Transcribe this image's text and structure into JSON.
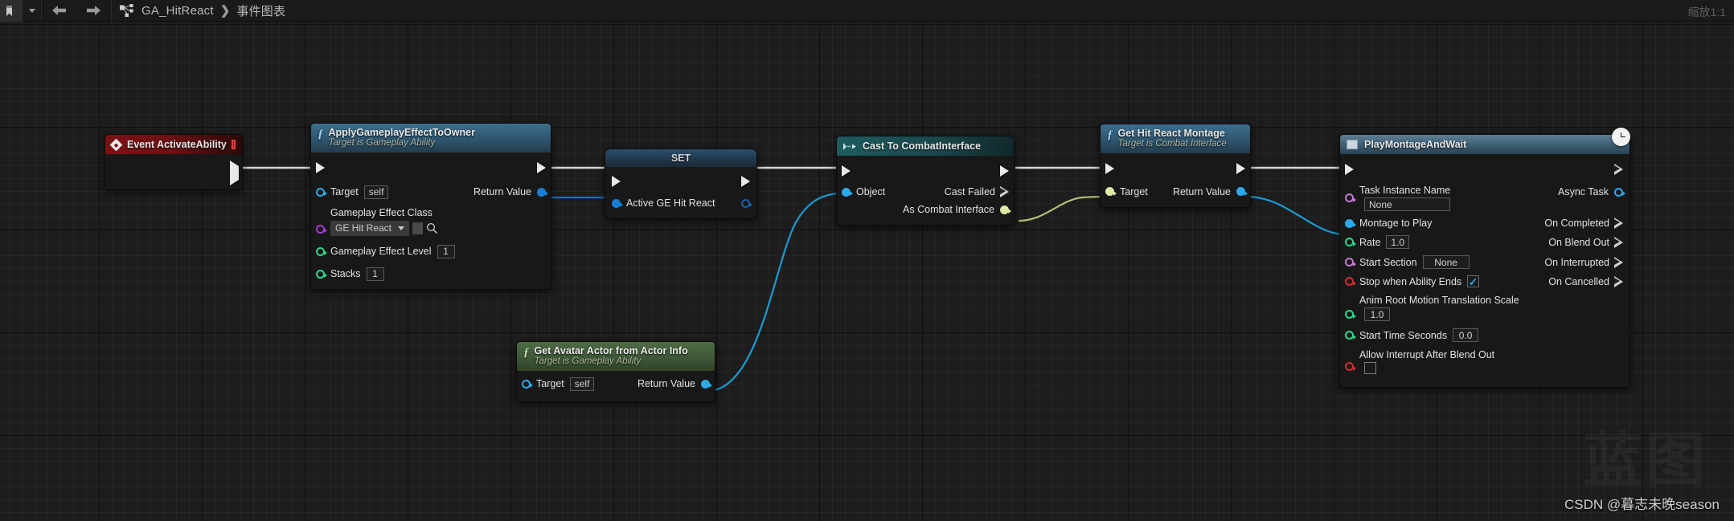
{
  "window": {
    "zoom_label": "缩放1:1"
  },
  "toolbar": {
    "bookmark_icon": "bookmark-icon",
    "bookmark_caret_icon": "chevron-down-icon",
    "back_icon": "arrow-left-icon",
    "forward_icon": "arrow-right-icon",
    "graph_icon": "blueprint-graph-icon",
    "breadcrumb": {
      "blueprint": "GA_HitReact",
      "separator": "❯",
      "graph": "事件图表"
    }
  },
  "watermark": {
    "big": "蓝图",
    "credit": "CSDN @暮志未晚season"
  },
  "nodes": {
    "event_activate_ability": {
      "title": "Event ActivateAbility",
      "icon": "event-diamond-icon",
      "stop_icon": "stop-square-icon",
      "exec_out": "exec-out-pin"
    },
    "apply_gameplay_effect": {
      "title": "ApplyGameplayEffectToOwner",
      "subtitle": "Target is Gameplay Ability",
      "icon": "function-f-icon",
      "inputs": [
        {
          "label": "Target",
          "value": "self",
          "pin_color": "#2da8e8",
          "pin_style": "hollow"
        },
        {
          "label": "Gameplay Effect Class",
          "value": "GE Hit React",
          "pin_color": "#a33bd6",
          "pin_style": "hollow",
          "kind": "class-combo"
        },
        {
          "label": "Gameplay Effect Level",
          "value": "1",
          "pin_color": "#2fd68a",
          "pin_style": "hollow"
        },
        {
          "label": "Stacks",
          "value": "1",
          "pin_color": "#2fd68a",
          "pin_style": "hollow"
        }
      ],
      "outputs": [
        {
          "label": "Return Value",
          "pin_color": "#1a7fd4",
          "pin_style": "filled"
        }
      ]
    },
    "set_node": {
      "title": "SET",
      "inputs": [
        {
          "label": "Active GE Hit React",
          "pin_color": "#1a7fd4",
          "pin_style": "filled"
        }
      ],
      "outputs": [
        {
          "label": "",
          "pin_color": "#1a5fa8",
          "pin_style": "hollow"
        }
      ]
    },
    "cast_to_combat_interface": {
      "title": "Cast To CombatInterface",
      "icon": "cast-arrow-icon",
      "inputs": [
        {
          "label": "Object",
          "pin_color": "#2da8e8",
          "pin_style": "filled"
        }
      ],
      "outputs": [
        {
          "label": "Cast Failed",
          "kind": "exec"
        },
        {
          "label": "As Combat Interface",
          "pin_color": "#dfe8a6",
          "pin_style": "filled"
        }
      ]
    },
    "get_hit_react_montage": {
      "title": "Get Hit React Montage",
      "subtitle": "Target is Combat Interface",
      "icon": "function-f-icon",
      "inputs": [
        {
          "label": "Target",
          "pin_color": "#dfe8a6",
          "pin_style": "filled"
        }
      ],
      "outputs": [
        {
          "label": "Return Value",
          "pin_color": "#2da8e8",
          "pin_style": "filled"
        }
      ]
    },
    "get_avatar_actor": {
      "title": "Get Avatar Actor from Actor Info",
      "subtitle": "Target is Gameplay Ability",
      "icon": "function-f-icon",
      "inputs": [
        {
          "label": "Target",
          "value": "self",
          "pin_color": "#2da8e8",
          "pin_style": "hollow"
        }
      ],
      "outputs": [
        {
          "label": "Return Value",
          "pin_color": "#2da8e8",
          "pin_style": "filled"
        }
      ]
    },
    "play_montage_and_wait": {
      "title": "PlayMontageAndWait",
      "icon": "async-task-icon",
      "latent_icon": "clock-icon",
      "inputs": [
        {
          "label": "Task Instance Name",
          "value": "None",
          "pin_color": "#c879d6",
          "pin_style": "hollow",
          "stacked": true
        },
        {
          "label": "Montage to Play",
          "value": "",
          "pin_color": "#2da8e8",
          "pin_style": "filled"
        },
        {
          "label": "Rate",
          "value": "1.0",
          "pin_color": "#2fd68a",
          "pin_style": "hollow"
        },
        {
          "label": "Start Section",
          "value": "None",
          "pin_color": "#c879d6",
          "pin_style": "hollow"
        },
        {
          "label": "Stop when Ability Ends",
          "value": "checked",
          "pin_color": "#d42b2b",
          "pin_style": "hollow",
          "kind": "checkbox"
        },
        {
          "label": "Anim Root Motion Translation Scale",
          "value": "1.0",
          "pin_color": "#2fd68a",
          "pin_style": "hollow",
          "stacked": true
        },
        {
          "label": "Start Time Seconds",
          "value": "0.0",
          "pin_color": "#2fd68a",
          "pin_style": "hollow"
        },
        {
          "label": "Allow Interrupt After Blend Out",
          "value": "unchecked",
          "pin_color": "#d42b2b",
          "pin_style": "hollow",
          "kind": "checkbox",
          "stacked": true
        }
      ],
      "outputs": [
        {
          "label": "Async Task",
          "pin_color": "#2da8e8",
          "pin_style": "hollow"
        },
        {
          "label": "On Completed",
          "kind": "exec"
        },
        {
          "label": "On Blend Out",
          "kind": "exec"
        },
        {
          "label": "On Interrupted",
          "kind": "exec"
        },
        {
          "label": "On Cancelled",
          "kind": "exec"
        }
      ]
    }
  }
}
